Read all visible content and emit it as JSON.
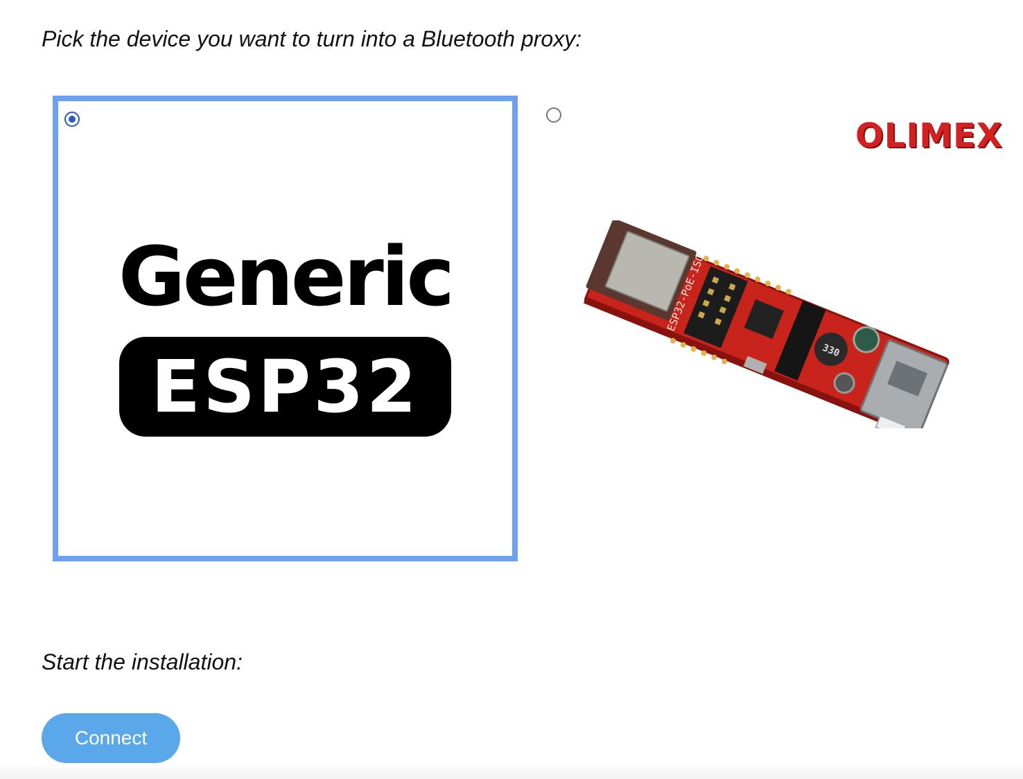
{
  "prompts": {
    "pick": "Pick the device you want to turn into a Bluetooth proxy:",
    "install": "Start the installation:"
  },
  "options": [
    {
      "id": "generic-esp32",
      "selected": true,
      "title": "Generic",
      "badge": "ESP32"
    },
    {
      "id": "olimex-esp32-poe-iso",
      "selected": false,
      "brand_logo": "OLIMEX",
      "board_silkscreen": "ESP32-PoE-ISO",
      "inductor_marking": "330"
    }
  ],
  "connect_button": {
    "label": "Connect"
  },
  "colors": {
    "selection_border": "#6ea0f0",
    "radio_selected": "#2a56c6",
    "button_bg": "#5aa8ea",
    "board_red": "#c8241c"
  }
}
